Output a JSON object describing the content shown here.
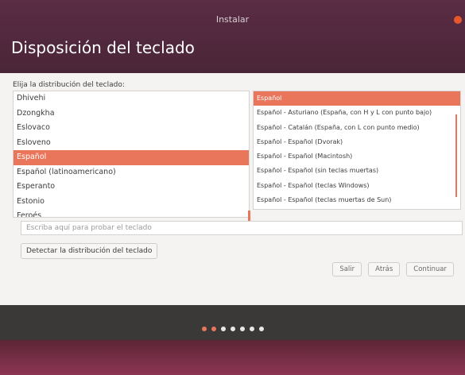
{
  "window": {
    "title": "Instalar",
    "page_title": "Disposición del teclado"
  },
  "prompt": "Elija la distribución del teclado:",
  "layouts": [
    {
      "label": "Dhivehi",
      "selected": false
    },
    {
      "label": "Dzongkha",
      "selected": false
    },
    {
      "label": "Eslovaco",
      "selected": false
    },
    {
      "label": "Esloveno",
      "selected": false
    },
    {
      "label": "Español",
      "selected": true
    },
    {
      "label": "Español (latinoamericano)",
      "selected": false
    },
    {
      "label": "Esperanto",
      "selected": false
    },
    {
      "label": "Estonio",
      "selected": false
    },
    {
      "label": "Feroés",
      "selected": false
    }
  ],
  "variants": [
    {
      "label": "Español",
      "selected": true
    },
    {
      "label": "Español - Asturiano (España, con H y L con punto bajo)",
      "selected": false
    },
    {
      "label": "Español - Catalán (España, con L con punto medio)",
      "selected": false
    },
    {
      "label": "Español - Español (Dvorak)",
      "selected": false
    },
    {
      "label": "Español - Español (Macintosh)",
      "selected": false
    },
    {
      "label": "Español - Español (sin teclas muertas)",
      "selected": false
    },
    {
      "label": "Español - Español (teclas Windows)",
      "selected": false
    },
    {
      "label": "Español - Español (teclas muertas de Sun)",
      "selected": false
    }
  ],
  "test_input": {
    "placeholder": "Escriba aquí para probar el teclado",
    "value": ""
  },
  "detect_button": "Detectar la distribución del teclado",
  "buttons": {
    "quit": "Salir",
    "back": "Atrás",
    "continue": "Continuar"
  },
  "progress": {
    "total_steps": 7,
    "completed_steps": 2
  },
  "colors": {
    "accent": "#e9765b",
    "titlebar": "#4a2538",
    "close": "#e5582c"
  }
}
